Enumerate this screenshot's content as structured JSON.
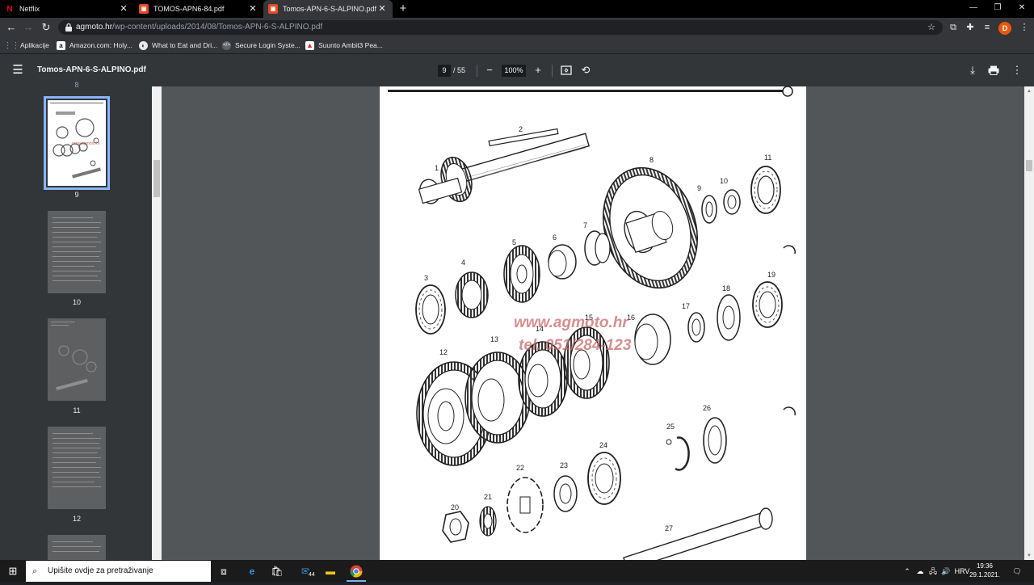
{
  "browser": {
    "tabs": [
      {
        "title": "Netflix",
        "icon": "netflix-icon",
        "active": false
      },
      {
        "title": "TOMOS-APN6-84.pdf",
        "icon": "pdf-icon",
        "active": false
      },
      {
        "title": "Tomos-APN-6-S-ALPINO.pdf",
        "icon": "pdf-icon",
        "active": true
      }
    ],
    "new_tab_label": "+",
    "url_host": "agmoto.hr",
    "url_path": "/wp-content/uploads/2014/08/Tomos-APN-6-S-ALPINO.pdf",
    "profile_initial": "D",
    "bookmarks": [
      {
        "label": "Aplikacije",
        "icon": "apps-grid-icon"
      },
      {
        "label": "Amazon.com: Holy...",
        "icon": "amazon-icon"
      },
      {
        "label": "What to Eat and Dri...",
        "icon": "globe-icon"
      },
      {
        "label": "Secure Login Syste...",
        "icon": "secure-login-icon"
      },
      {
        "label": "Suunto Ambit3 Pea...",
        "icon": "suunto-icon"
      }
    ]
  },
  "pdf": {
    "title": "Tomos-APN-6-S-ALPINO.pdf",
    "current_page": "9",
    "page_separator": "/ 55",
    "zoom": "100%",
    "thumbnails": [
      {
        "number": "8"
      },
      {
        "number": "9",
        "selected": true
      },
      {
        "number": "10"
      },
      {
        "number": "11"
      },
      {
        "number": "12"
      }
    ],
    "part_numbers": [
      "1",
      "2",
      "3",
      "4",
      "5",
      "6",
      "7",
      "8",
      "9",
      "10",
      "11",
      "12",
      "13",
      "14",
      "15",
      "16",
      "17",
      "18",
      "19",
      "20",
      "21",
      "22",
      "23",
      "24",
      "25",
      "26",
      "27"
    ],
    "watermark_line1": "www.agmoto.hr",
    "watermark_line2": "tel. 051/284-123"
  },
  "taskbar": {
    "search_placeholder": "Upišite ovdje za pretraživanje",
    "mail_badge": "44",
    "language": "HRV",
    "time": "19:36",
    "date": "29.1.2021."
  }
}
